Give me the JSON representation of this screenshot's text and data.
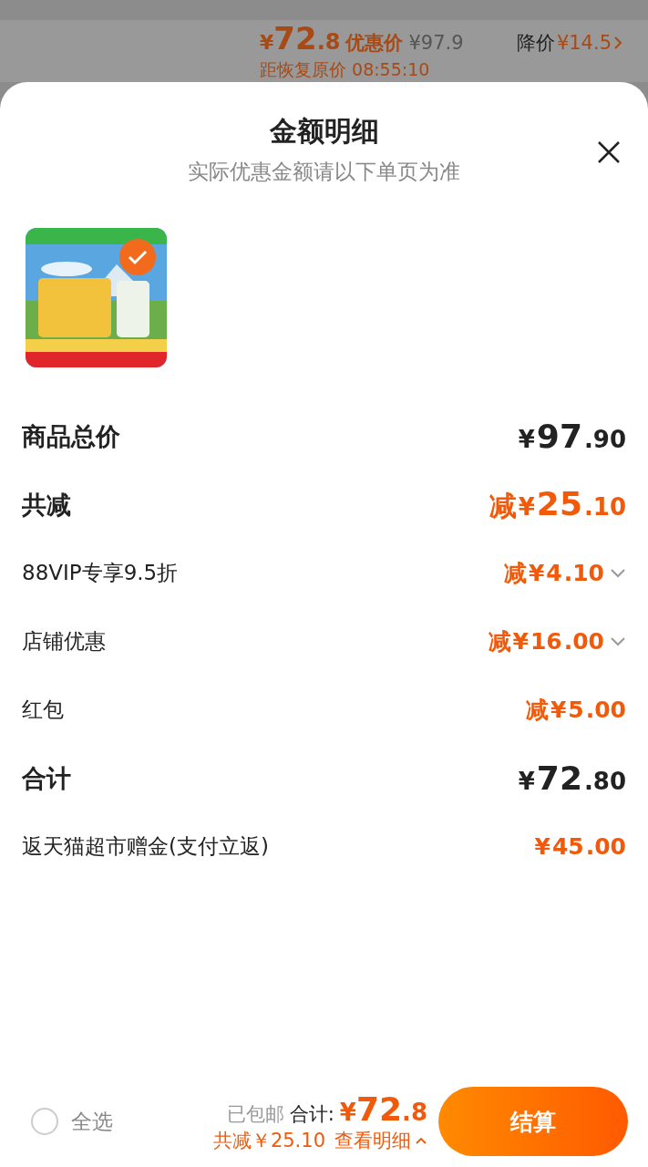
{
  "background_header": {
    "price": {
      "currency": "¥",
      "integer": "72",
      "decimal": ".8"
    },
    "price_label": "优惠价",
    "original_price": "¥97.9",
    "drop_label": "降价",
    "drop_amount": "¥14.5",
    "countdown": "距恢复原价 08:55:10"
  },
  "sheet": {
    "title": "金额明细",
    "subtitle": "实际优惠金额请以下单页为准",
    "product": {
      "kind": "picture",
      "selected": true
    },
    "rows": [
      {
        "label": "商品总价",
        "kind": "main",
        "accent": false,
        "prefix": "",
        "currency": "¥",
        "integer": "97",
        "decimal": ".90",
        "expandable": false
      },
      {
        "label": "共减",
        "kind": "main",
        "accent": true,
        "prefix": "减",
        "currency": "¥",
        "integer": "25",
        "decimal": ".10",
        "expandable": false
      },
      {
        "label": "88VIP专享9.5折",
        "kind": "sub",
        "accent": true,
        "prefix": "减",
        "currency": "¥",
        "integer": "4",
        "decimal": ".10",
        "expandable": true
      },
      {
        "label": "店铺优惠",
        "kind": "sub",
        "accent": true,
        "prefix": "减",
        "currency": "¥",
        "integer": "16",
        "decimal": ".00",
        "expandable": true
      },
      {
        "label": "红包",
        "kind": "sub",
        "accent": true,
        "prefix": "减",
        "currency": "¥",
        "integer": "5",
        "decimal": ".00",
        "expandable": false
      },
      {
        "label": "合计",
        "kind": "main",
        "accent": false,
        "prefix": "",
        "currency": "¥",
        "integer": "72",
        "decimal": ".80",
        "expandable": false
      },
      {
        "label": "返天猫超市赠金(支付立返)",
        "kind": "sub",
        "accent": true,
        "prefix": "",
        "currency": "¥",
        "integer": "45",
        "decimal": ".00",
        "expandable": false
      }
    ]
  },
  "footer": {
    "select_all": {
      "label": "全选",
      "checked": false
    },
    "shipping": "已包邮",
    "total_label": "合计:",
    "total": {
      "currency": "¥",
      "integer": "72",
      "decimal": ".8"
    },
    "savings": "共减￥25.10",
    "details_link": "查看明细",
    "checkout": "结算"
  }
}
